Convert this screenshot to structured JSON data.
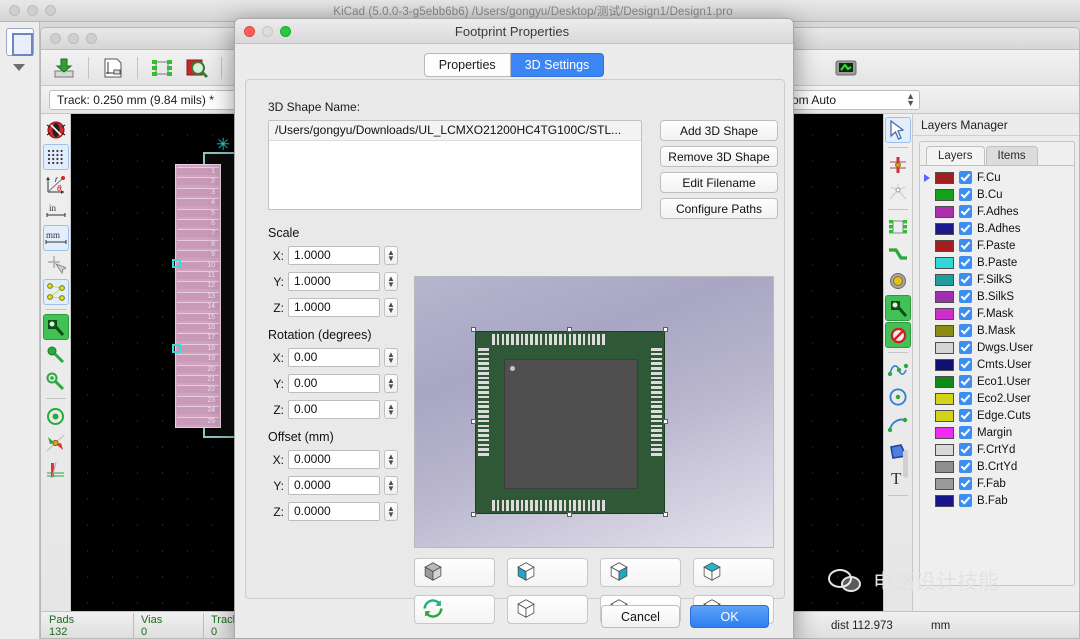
{
  "app": {
    "window_title": "KiCad (5.0.0-3-g5ebb6b6) /Users/gongyu/Desktop/测试/Design1/Design1.pro"
  },
  "toolbar": {
    "track_label": "Track: 0.250 mm (9.84 mils) *",
    "zoom_label": "Zoom Auto",
    "icons": [
      "save-board-icon",
      "page-settings-icon",
      "footprint-editor-icon",
      "footprint-viewer-icon",
      "undo-icon",
      "3d-viewer-icon"
    ]
  },
  "left_tools": [
    {
      "name": "drc-icon",
      "selected": false
    },
    {
      "name": "grid-display-icon",
      "selected": true
    },
    {
      "name": "polar-coordinates-icon",
      "selected": false
    },
    {
      "name": "units-inches-icon",
      "selected": false
    },
    {
      "name": "units-millimeters-icon",
      "selected": true
    },
    {
      "name": "cursor-shape-icon",
      "selected": false
    },
    {
      "name": "show-ratsnest-icon",
      "selected": true
    },
    {
      "name": "show-filled-tracks-icon",
      "selected": true
    },
    {
      "name": "show-outline-vias-icon",
      "selected": false
    },
    {
      "name": "show-filled-zones-icon",
      "selected": true
    },
    {
      "name": "show-zone-outlines-icon",
      "selected": false
    },
    {
      "name": "high-contrast-icon",
      "selected": false
    },
    {
      "name": "layer-alignment-icon",
      "selected": false
    }
  ],
  "right_tools": [
    {
      "name": "select-cursor-icon",
      "selected": true
    },
    {
      "name": "highlight-net-icon",
      "selected": false
    },
    {
      "name": "local-ratsnest-icon",
      "selected": false
    },
    {
      "name": "add-footprint-icon",
      "selected": false
    },
    {
      "name": "route-track-icon",
      "selected": false
    },
    {
      "name": "add-via-icon",
      "selected": false
    },
    {
      "name": "add-zone-icon",
      "selected": true
    },
    {
      "name": "add-keepout-area-icon",
      "selected": true
    },
    {
      "name": "add-polyline-icon",
      "selected": false
    },
    {
      "name": "add-circle-icon",
      "selected": false
    },
    {
      "name": "add-arc-icon",
      "selected": false
    },
    {
      "name": "add-graphic-polygon-icon",
      "selected": false
    },
    {
      "name": "add-text-icon",
      "selected": false
    }
  ],
  "layers_panel": {
    "title": "Layers Manager",
    "tabs": [
      {
        "label": "Layers",
        "active": true
      },
      {
        "label": "Items",
        "active": false
      }
    ],
    "layers": [
      {
        "name": "F.Cu",
        "color": "#a31f1f",
        "visible": true,
        "active": true
      },
      {
        "name": "B.Cu",
        "color": "#15a117",
        "visible": true,
        "active": false
      },
      {
        "name": "F.Adhes",
        "color": "#ad2fad",
        "visible": true,
        "active": false
      },
      {
        "name": "B.Adhes",
        "color": "#1a1a8c",
        "visible": true,
        "active": false
      },
      {
        "name": "F.Paste",
        "color": "#a81d1d",
        "visible": true,
        "active": false
      },
      {
        "name": "B.Paste",
        "color": "#32d6d6",
        "visible": true,
        "active": false
      },
      {
        "name": "F.SilkS",
        "color": "#1f9c9c",
        "visible": true,
        "active": false
      },
      {
        "name": "B.SilkS",
        "color": "#a02fb0",
        "visible": true,
        "active": false
      },
      {
        "name": "F.Mask",
        "color": "#cc2fcc",
        "visible": true,
        "active": false
      },
      {
        "name": "B.Mask",
        "color": "#8c8c12",
        "visible": true,
        "active": false
      },
      {
        "name": "Dwgs.User",
        "color": "#d4d4d4",
        "visible": true,
        "active": false
      },
      {
        "name": "Cmts.User",
        "color": "#101070",
        "visible": true,
        "active": false
      },
      {
        "name": "Eco1.User",
        "color": "#0f8a1a",
        "visible": true,
        "active": false
      },
      {
        "name": "Eco2.User",
        "color": "#d3d317",
        "visible": true,
        "active": false
      },
      {
        "name": "Edge.Cuts",
        "color": "#d3d317",
        "visible": true,
        "active": false
      },
      {
        "name": "Margin",
        "color": "#ee2bee",
        "visible": true,
        "active": false
      },
      {
        "name": "F.CrtYd",
        "color": "#d8d8d8",
        "visible": true,
        "active": false
      },
      {
        "name": "B.CrtYd",
        "color": "#8e8e8e",
        "visible": true,
        "active": false
      },
      {
        "name": "F.Fab",
        "color": "#9a9a9a",
        "visible": true,
        "active": false
      },
      {
        "name": "B.Fab",
        "color": "#14148c",
        "visible": true,
        "active": false
      }
    ]
  },
  "status_bar": {
    "columns": [
      {
        "header": "Pads",
        "value": "132"
      },
      {
        "header": "Vias",
        "value": "0"
      },
      {
        "header": "Track Segments",
        "value": "0"
      }
    ],
    "dist": "dist 112.973",
    "unit": "mm"
  },
  "watermark": {
    "text": "电路设计技能",
    "icon": "wechat-icon"
  },
  "canvas": {
    "pad_numbers": [
      "1",
      "2",
      "3",
      "4",
      "5",
      "6",
      "7",
      "8",
      "9",
      "10",
      "11",
      "12",
      "13",
      "14",
      "15",
      "16",
      "17",
      "18",
      "19",
      "20",
      "21",
      "22",
      "23",
      "24",
      "25"
    ],
    "anchor_marker": "footprint-anchor-star"
  },
  "dialog": {
    "title": "Footprint Properties",
    "tabs": [
      {
        "label": "Properties",
        "active": false
      },
      {
        "label": "3D Settings",
        "active": true
      }
    ],
    "shape_name_label": "3D Shape Name:",
    "shape_path": "/Users/gongyu/Downloads/UL_LCMXO21200HC4TG100C/STL...",
    "side_buttons": [
      "Add 3D Shape",
      "Remove 3D Shape",
      "Edit Filename",
      "Configure Paths"
    ],
    "scale": {
      "label": "Scale",
      "fields": [
        {
          "axis": "X:",
          "value": "1.0000"
        },
        {
          "axis": "Y:",
          "value": "1.0000"
        },
        {
          "axis": "Z:",
          "value": "1.0000"
        }
      ]
    },
    "rotation": {
      "label": "Rotation (degrees)",
      "fields": [
        {
          "axis": "X:",
          "value": "0.00"
        },
        {
          "axis": "Y:",
          "value": "0.00"
        },
        {
          "axis": "Z:",
          "value": "0.00"
        }
      ]
    },
    "offset": {
      "label": "Offset (mm)",
      "fields": [
        {
          "axis": "X:",
          "value": "0.0000"
        },
        {
          "axis": "Y:",
          "value": "0.0000"
        },
        {
          "axis": "Z:",
          "value": "0.0000"
        }
      ]
    },
    "view_buttons": [
      {
        "name": "view-isometric-icon"
      },
      {
        "name": "view-left-icon"
      },
      {
        "name": "view-front-icon"
      },
      {
        "name": "view-right-icon"
      },
      {
        "name": "view-reset-rotation-icon"
      },
      {
        "name": "view-top-icon"
      },
      {
        "name": "view-back-icon"
      },
      {
        "name": "view-bottom-icon"
      }
    ],
    "footer": {
      "cancel": "Cancel",
      "ok": "OK"
    }
  }
}
